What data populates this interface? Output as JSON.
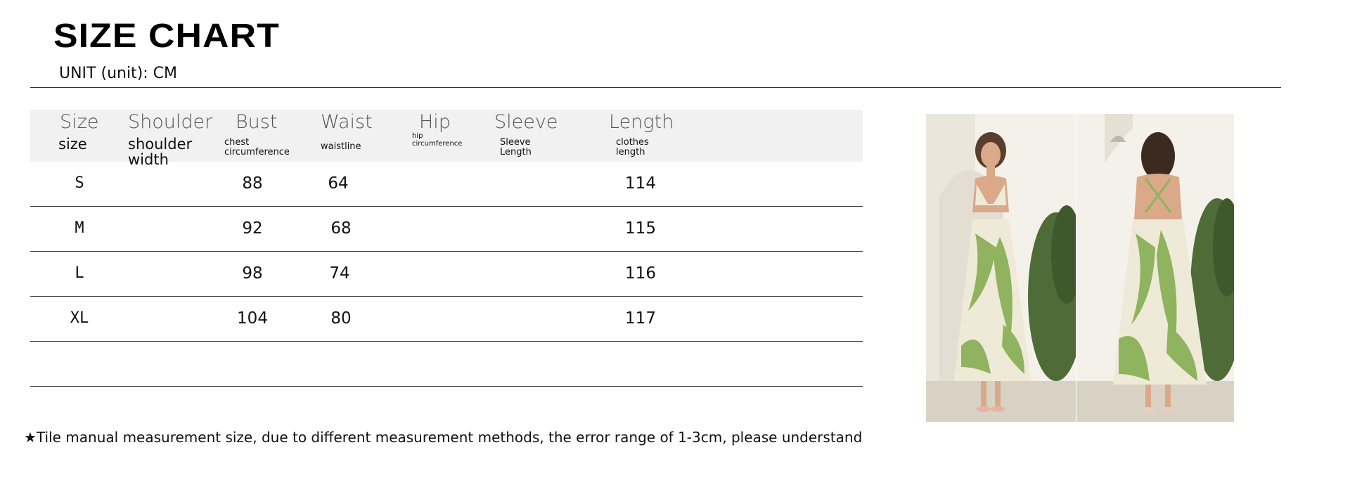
{
  "title": "SIZE CHART",
  "unit_label": "UNIT (unit): CM",
  "headers": [
    {
      "en": "Size",
      "cn": "size"
    },
    {
      "en": "Shoulder",
      "cn": "shoulder width"
    },
    {
      "en": "Bust",
      "cn": "chest circumference"
    },
    {
      "en": "Waist",
      "cn": "waistline"
    },
    {
      "en": "Hip",
      "cn": "hip circumference"
    },
    {
      "en": "Sleeve",
      "cn": "Sleeve Length"
    },
    {
      "en": "Length",
      "cn": "clothes length"
    }
  ],
  "rows": [
    {
      "size": "S",
      "shoulder": "",
      "bust": "88",
      "waist": "64",
      "hip": "",
      "sleeve": "",
      "length": "114"
    },
    {
      "size": "M",
      "shoulder": "",
      "bust": "92",
      "waist": "68",
      "hip": "",
      "sleeve": "",
      "length": "115"
    },
    {
      "size": "L",
      "shoulder": "",
      "bust": "98",
      "waist": "74",
      "hip": "",
      "sleeve": "",
      "length": "116"
    },
    {
      "size": "XL",
      "shoulder": "",
      "bust": "104",
      "waist": "80",
      "hip": "",
      "sleeve": "",
      "length": "117"
    }
  ],
  "note": "★Tile manual measurement size, due to different measurement methods, the error range of 1-3cm, please understand",
  "colors": {
    "header_bg": "#f1f1f1",
    "dress_green": "#8fb35e",
    "dress_cream": "#efe9d8",
    "wall": "#f4f1ea"
  }
}
